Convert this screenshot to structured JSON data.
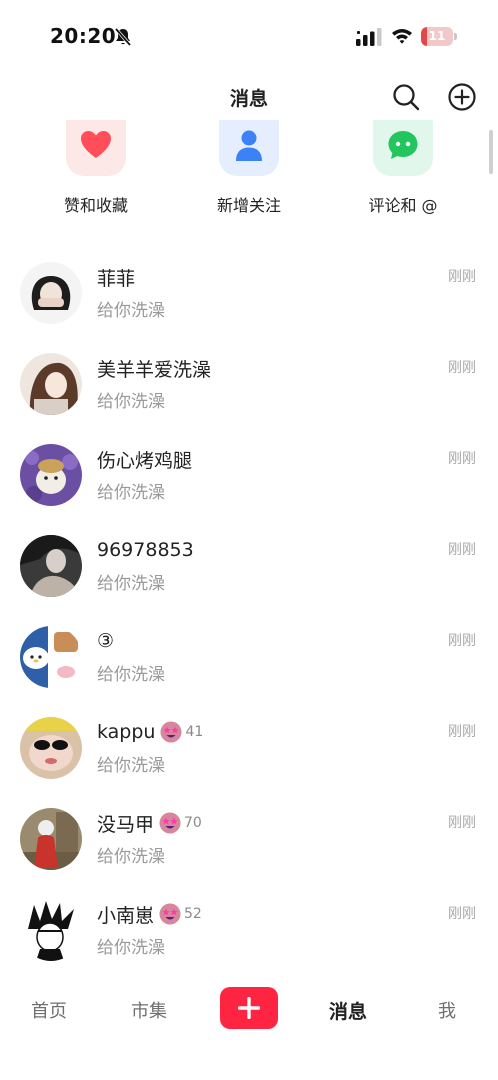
{
  "status_bar": {
    "time": "20:20",
    "battery_level": "11",
    "battery_fraction": 0.11,
    "icons": [
      "bell-muted-icon",
      "signal-icon",
      "wifi-icon",
      "battery-icon"
    ]
  },
  "header": {
    "title": "消息",
    "icons": [
      "search-icon",
      "plus-circle-icon"
    ]
  },
  "quick_actions": [
    {
      "label": "赞和收藏",
      "icon": "heart-icon",
      "color": "#ff4d5a"
    },
    {
      "label": "新增关注",
      "icon": "person-icon",
      "color": "#3b82f6"
    },
    {
      "label": "评论和 @",
      "icon": "chat-bubble-icon",
      "color": "#22c55e"
    }
  ],
  "messages": [
    {
      "name": "菲菲",
      "preview": "给你洗澡",
      "time": "刚刚",
      "level": ""
    },
    {
      "name": "美羊羊爱洗澡",
      "preview": "给你洗澡",
      "time": "刚刚",
      "level": ""
    },
    {
      "name": "伤心烤鸡腿",
      "preview": "给你洗澡",
      "time": "刚刚",
      "level": ""
    },
    {
      "name": "96978853",
      "preview": "给你洗澡",
      "time": "刚刚",
      "level": ""
    },
    {
      "name": "③",
      "preview": "给你洗澡",
      "time": "刚刚",
      "level": ""
    },
    {
      "name": "kappu",
      "preview": "给你洗澡",
      "time": "刚刚",
      "level": "41"
    },
    {
      "name": "没马甲",
      "preview": "给你洗澡",
      "time": "刚刚",
      "level": "70"
    },
    {
      "name": "小南崽",
      "preview": "给你洗澡",
      "time": "刚刚",
      "level": "52"
    }
  ],
  "bottom_nav": {
    "home": "首页",
    "market": "市集",
    "messages": "消息",
    "me": "我",
    "active": "消息",
    "publish_icon": "plus-icon",
    "accent": "#ff2442"
  }
}
